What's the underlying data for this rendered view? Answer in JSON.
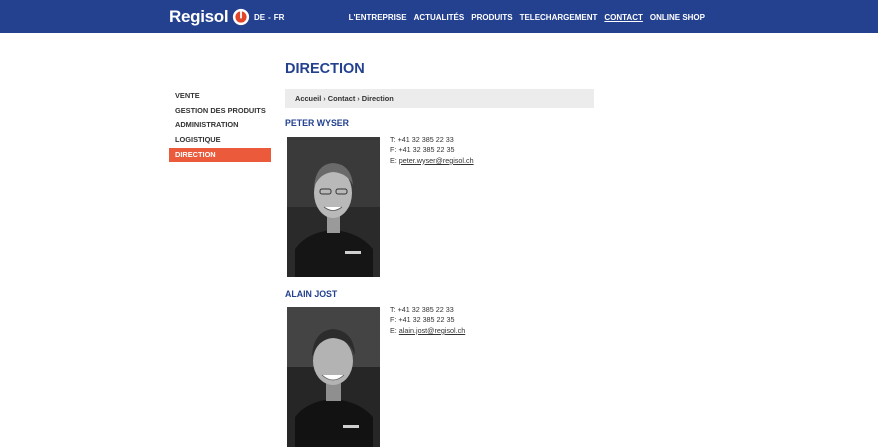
{
  "header": {
    "logo_text": "Regisol",
    "languages": [
      "DE",
      "FR"
    ],
    "lang_separator": "-",
    "nav": [
      "L'ENTREPRISE",
      "ACTUALITÉS",
      "PRODUITS",
      "TELECHARGEMENT",
      "CONTACT",
      "ONLINE SHOP"
    ],
    "active_nav": "CONTACT",
    "bar_color": "#24418f"
  },
  "sidebar": {
    "items": [
      "VENTE",
      "GESTION DES PRODUITS",
      "ADMINISTRATION",
      "LOGISTIQUE",
      "DIRECTION"
    ],
    "active": "DIRECTION",
    "active_color": "#ec5a3c"
  },
  "page": {
    "title": "DIRECTION",
    "breadcrumb": [
      "Accueil",
      "Contact",
      "Direction"
    ],
    "breadcrumb_separator": "›"
  },
  "people": [
    {
      "name": "PETER WYSER",
      "phone": "T: +41 32 385 22 33",
      "fax": "F: +41 32 385 22 35",
      "email_prefix": "E: ",
      "email": "peter.wyser@regisol.ch"
    },
    {
      "name": "ALAIN JOST",
      "phone": "T: +41 32 385 22 33",
      "fax": "F: +41 32 385 22 35",
      "email_prefix": "E: ",
      "email": "alain.jost@regisol.ch"
    }
  ]
}
